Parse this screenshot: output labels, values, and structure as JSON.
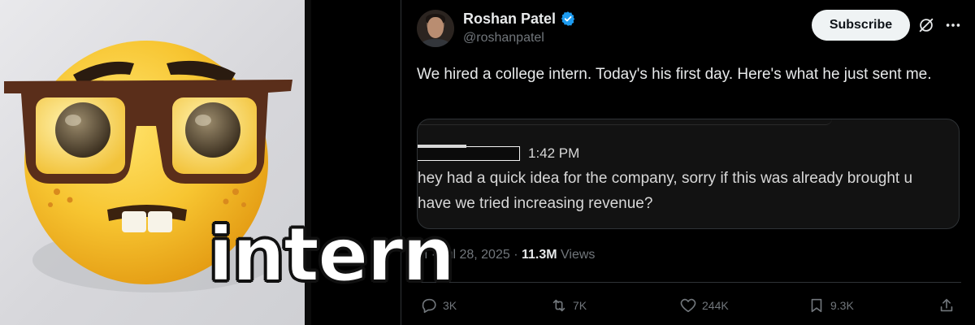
{
  "meme": {
    "caption": "intern"
  },
  "tweet": {
    "author_name": "Roshan Patel",
    "author_handle": "@roshanpatel",
    "subscribe_label": "Subscribe",
    "text": "We hired a college intern. Today's his first day. Here's what he just sent me.",
    "quoted_message": {
      "time": "1:42 PM",
      "line1": "hey had a quick idea for the company, sorry if this was already brought u",
      "line2": "have we tried increasing revenue?"
    },
    "meta": {
      "time_partial": "M",
      "date": "Jul 28, 2025",
      "views_count": "11.3M",
      "views_label": "Views"
    },
    "actions": {
      "replies": "3K",
      "reposts": "7K",
      "likes": "244K",
      "bookmarks": "9.3K"
    }
  },
  "colors": {
    "background": "#000000",
    "text_primary": "#e7e9ea",
    "text_secondary": "#71767b",
    "verified_blue": "#1d9bf0",
    "emoji_yellow": "#f7c531",
    "glasses_brown": "#5a2e1a"
  },
  "icons": [
    "verified-icon",
    "grok-icon",
    "more-icon",
    "reply-icon",
    "repost-icon",
    "like-icon",
    "bookmark-icon",
    "share-icon"
  ]
}
